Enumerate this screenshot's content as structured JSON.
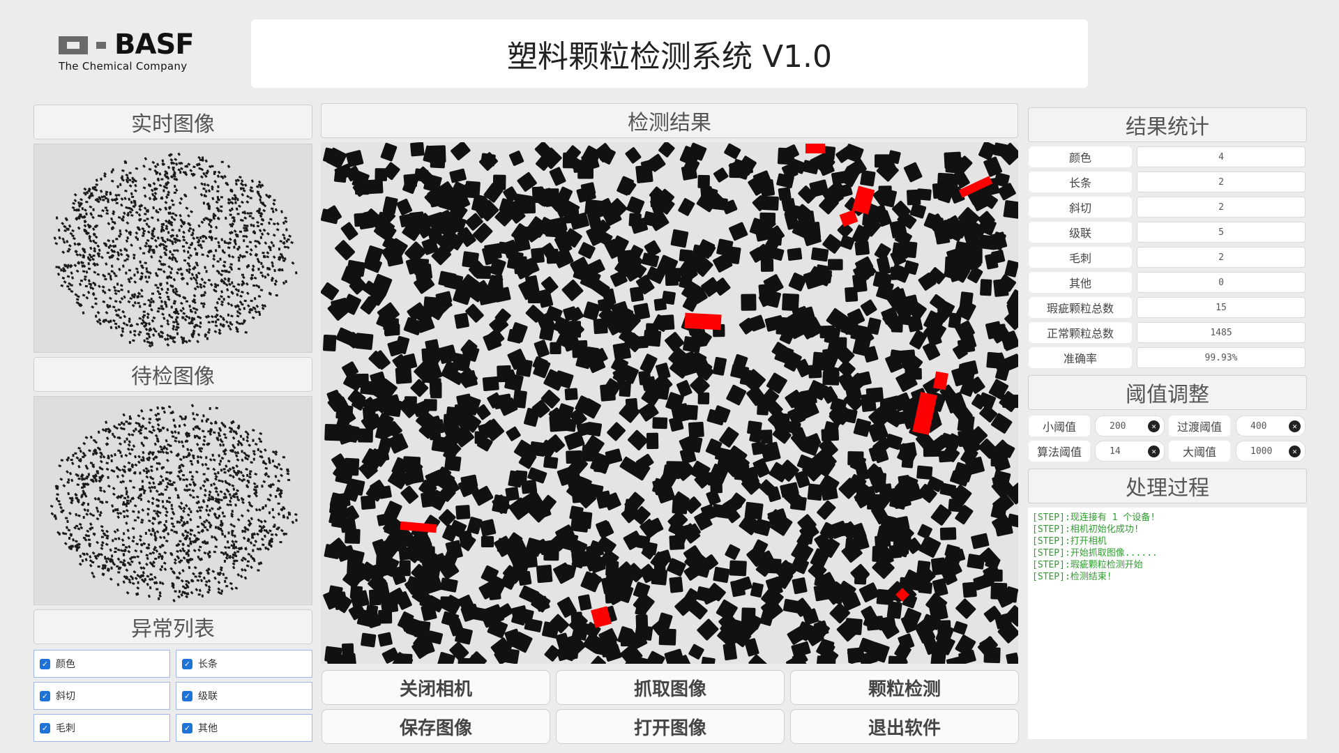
{
  "header": {
    "logo_word": "BASF",
    "logo_tagline": "The Chemical Company",
    "title": "塑料颗粒检测系统 V1.0"
  },
  "left": {
    "realtime_title": "实时图像",
    "pending_title": "待检图像",
    "anomaly_title": "异常列表",
    "anomalies": [
      {
        "label": "颜色",
        "checked": true
      },
      {
        "label": "长条",
        "checked": true
      },
      {
        "label": "斜切",
        "checked": true
      },
      {
        "label": "级联",
        "checked": true
      },
      {
        "label": "毛刺",
        "checked": true
      },
      {
        "label": "其他",
        "checked": true
      }
    ]
  },
  "center": {
    "result_title": "检测结果",
    "buttons": [
      "关闭相机",
      "抓取图像",
      "颗粒检测",
      "保存图像",
      "打开图像",
      "退出软件"
    ]
  },
  "right": {
    "stats_title": "结果统计",
    "stats": [
      {
        "label": "颜色",
        "value": "4"
      },
      {
        "label": "长条",
        "value": "2"
      },
      {
        "label": "斜切",
        "value": "2"
      },
      {
        "label": "级联",
        "value": "5"
      },
      {
        "label": "毛刺",
        "value": "2"
      },
      {
        "label": "其他",
        "value": "0"
      },
      {
        "label": "瑕疵颗粒总数",
        "value": "15"
      },
      {
        "label": "正常颗粒总数",
        "value": "1485"
      },
      {
        "label": "准确率",
        "value": "99.93%"
      }
    ],
    "threshold_title": "阈值调整",
    "thresholds": [
      {
        "label": "小阈值",
        "value": "200"
      },
      {
        "label": "过渡阈值",
        "value": "400"
      },
      {
        "label": "算法阈值",
        "value": "14"
      },
      {
        "label": "大阈值",
        "value": "1000"
      }
    ],
    "process_title": "处理过程",
    "log": [
      "[STEP]:现连接有 1 个设备!",
      "[STEP]:相机初始化成功!",
      "[STEP]:打开相机",
      "[STEP]:开始抓取图像......",
      "[STEP]:瑕疵颗粒检测开始",
      "[STEP]:检测结束!"
    ]
  },
  "colors": {
    "background": "#ececec",
    "pellet": "#111111",
    "defect": "#ff0000",
    "log_text": "#2e9b2e",
    "checkbox": "#1e73d8"
  }
}
